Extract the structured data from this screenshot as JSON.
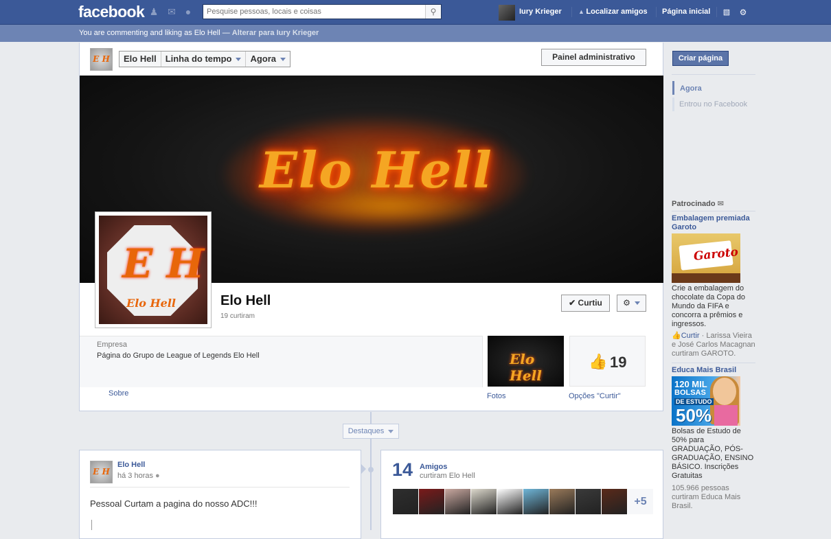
{
  "topbar": {
    "logo": "facebook",
    "search_placeholder": "Pesquise pessoas, locais e coisas",
    "user_name": "Iury Krieger",
    "find_friends": "Localizar amigos",
    "home": "Página inicial",
    "icons": [
      "friend-requests-icon",
      "messages-icon",
      "notifications-icon",
      "search-icon",
      "privacy-icon",
      "settings-gear-icon"
    ]
  },
  "subbar": {
    "text": "You are commenting and liking as Elo Hell —",
    "switch_link": "Alterar para Iury Krieger"
  },
  "page_nav": {
    "name_tab": "Elo Hell",
    "timeline_tab": "Linha do tempo",
    "now_tab": "Agora",
    "admin_button": "Painel administrativo"
  },
  "cover": {
    "text": "Elo Hell"
  },
  "profile": {
    "initials": "E H",
    "subtitle": "Elo Hell",
    "name": "Elo Hell",
    "likes_line": "19 curtiram",
    "like_button": "Curtiu"
  },
  "about": {
    "category": "Empresa",
    "description": "Página do Grupo de League of Legends Elo Hell",
    "link": "Sobre"
  },
  "photos": {
    "label": "Fotos",
    "thumb_text": "Elo Hell"
  },
  "likes_box": {
    "count": "19",
    "label": "Opções \"Curtir\""
  },
  "timeline": {
    "highlights": "Destaques"
  },
  "post": {
    "author": "Elo Hell",
    "time": "há 3 horas",
    "text": "Pessoal Curtam a pagina do nosso ADC!!!"
  },
  "friends": {
    "count": "14",
    "title": "Amigos",
    "subtitle": "curtiram Elo Hell",
    "more": "+5",
    "thumb_colors": [
      "#2e2e2e",
      "#7a1a1a",
      "#c9a8a0",
      "#dcd8cc",
      "#ffffff",
      "#6fb6d8",
      "#9a7a5a",
      "#3a3a3a",
      "#5a2a1a"
    ]
  },
  "right_col": {
    "create_page": "Criar página",
    "nav_now": "Agora",
    "nav_joined": "Entrou no Facebook",
    "sponsored": "Patrocinado",
    "ads": [
      {
        "title": "Embalagem premiada Garoto",
        "brand": "Garoto",
        "body": "Crie a embalagem do chocolate da Copa do Mundo da FIFA e concorra a prêmios e ingressos.",
        "like_link": "Curtir",
        "social": " · Larissa Vieira e José Carlos Macagnan curtiram GAROTO."
      },
      {
        "title": "Educa Mais Brasil",
        "img_line1": "120 MIL",
        "img_line2": "BOLSAS",
        "img_line3": "DE ESTUDO",
        "img_line4": "50%",
        "body": "Bolsas de Estudo de 50% para GRADUAÇÃO, PÓS-GRADUAÇÃO, ENSINO BÁSICO. Inscrições Gratuitas",
        "social": "105.966 pessoas curtiram Educa Mais Brasil."
      }
    ]
  }
}
